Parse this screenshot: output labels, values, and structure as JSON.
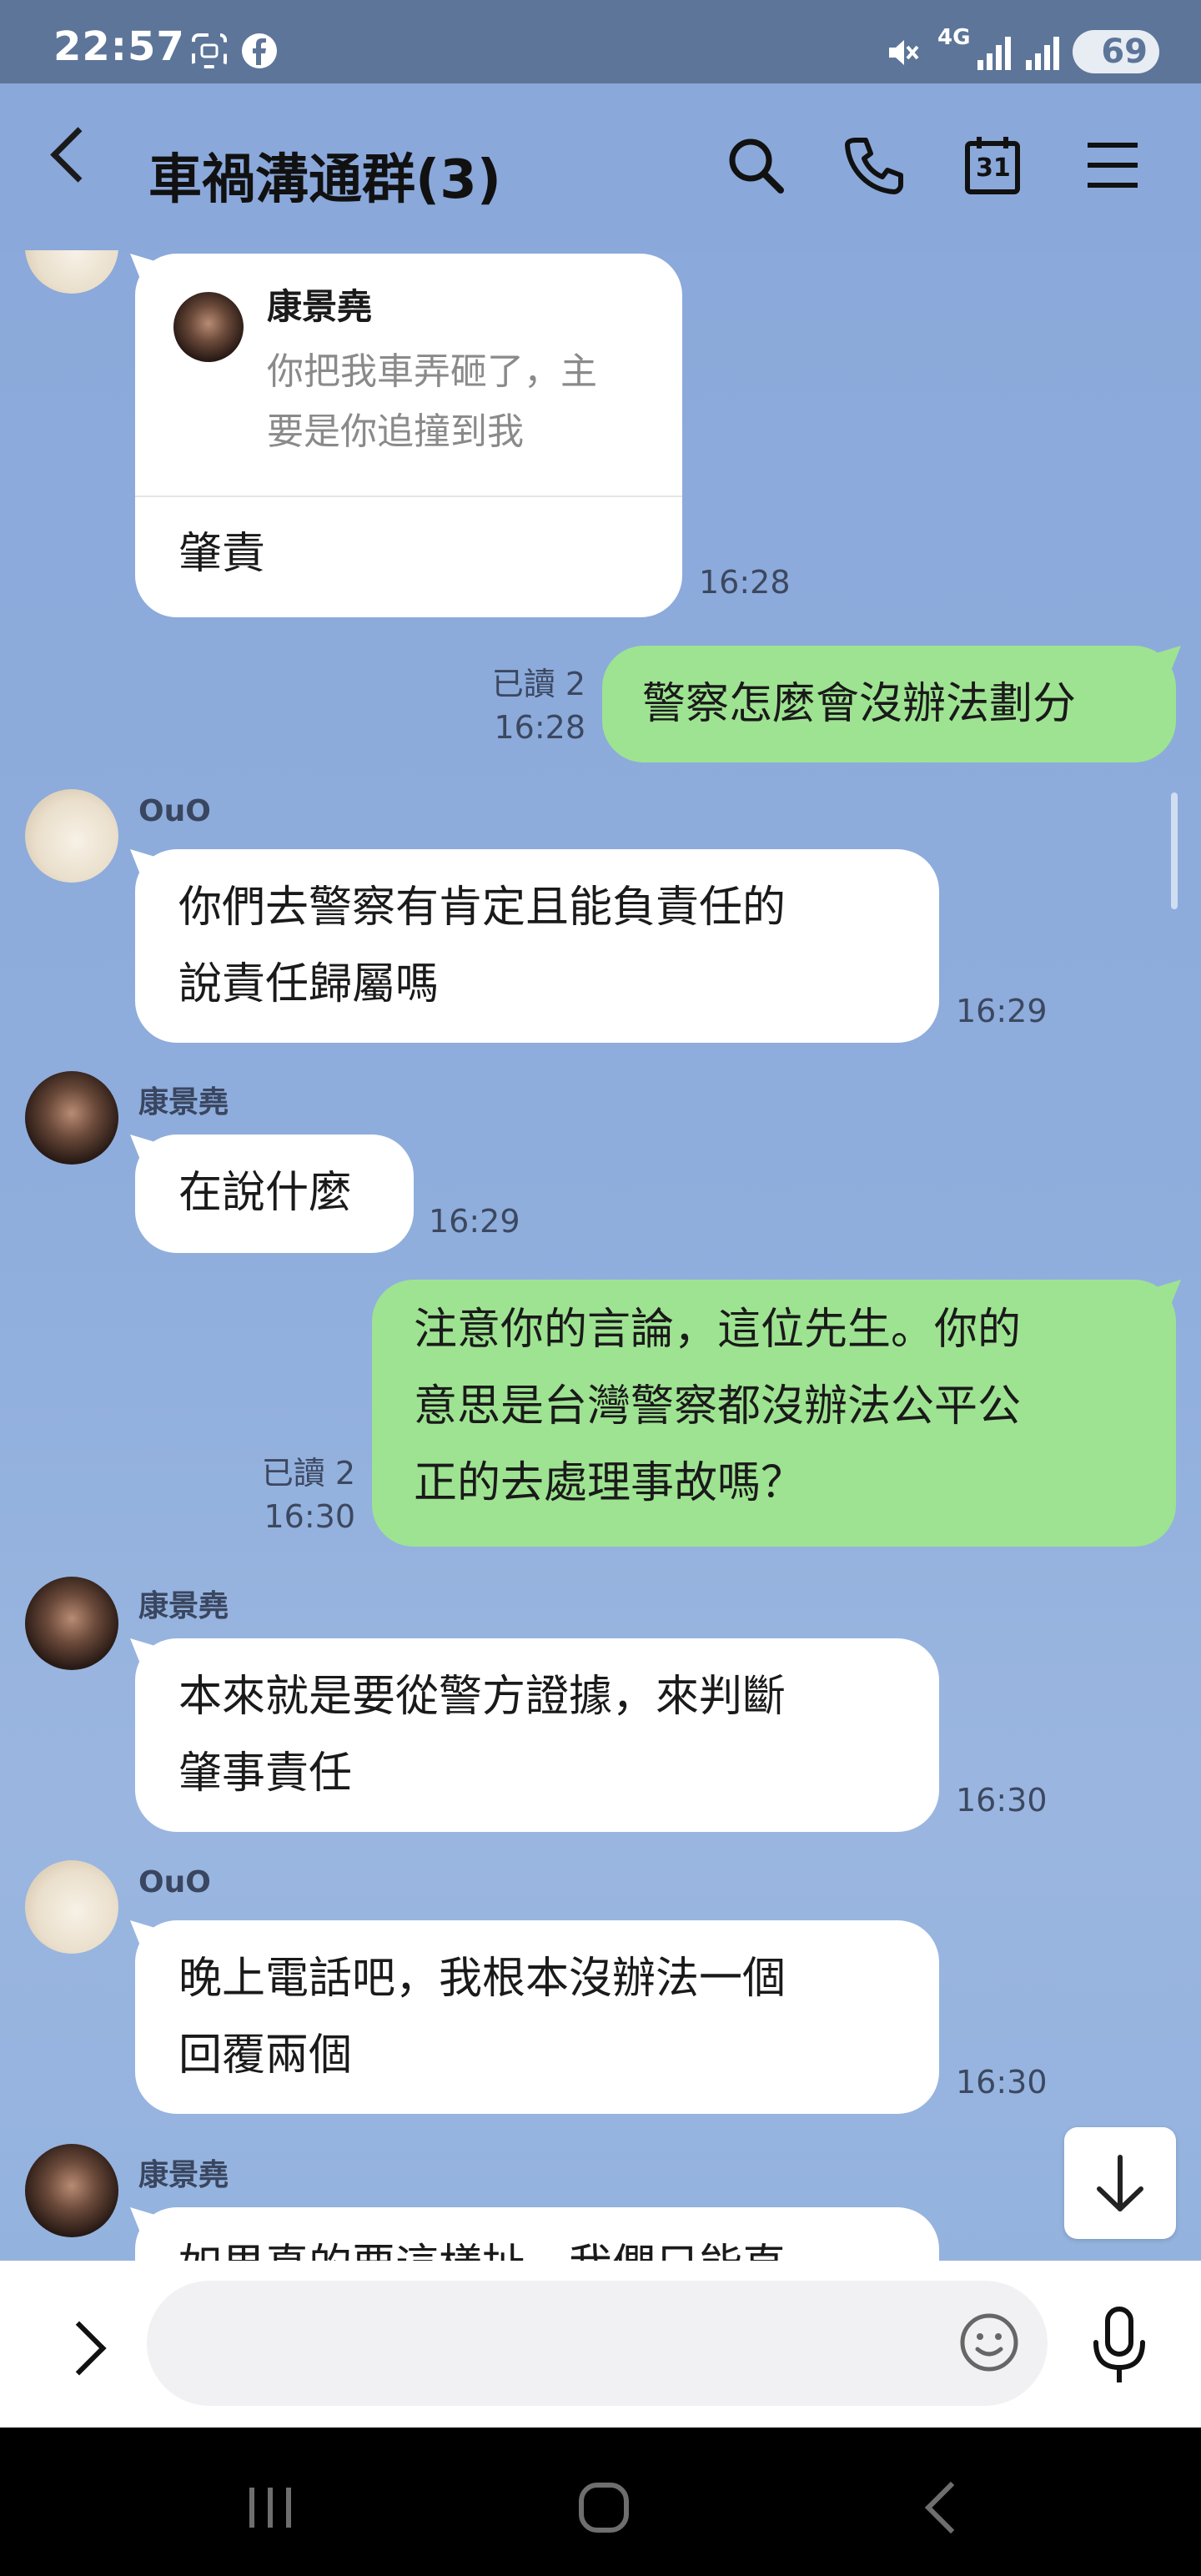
{
  "status_bar": {
    "time": "22:57",
    "network": "4G",
    "battery": "69",
    "icons": [
      "screenshot-icon",
      "facebook-icon",
      "mute-icon",
      "signal-icon",
      "signal-icon",
      "battery-icon"
    ]
  },
  "header": {
    "title": "車禍溝通群(3)",
    "icons": [
      "back-icon",
      "search-icon",
      "phone-icon",
      "calendar-icon",
      "menu-icon"
    ],
    "calendar_day": "31"
  },
  "messages": [
    {
      "id": "m1",
      "side": "left",
      "sender": "康景堯",
      "reply": {
        "name": "康景堯",
        "text": "你把我車弄砸了，主要是你追撞到我"
      },
      "text": "肇責",
      "time": "16:28"
    },
    {
      "id": "m2",
      "side": "right",
      "read": "已讀 2",
      "text": "警察怎麼會沒辦法劃分",
      "time": "16:28"
    },
    {
      "id": "m3",
      "side": "left",
      "sender": "OuO",
      "text": "你們去警察有肯定且能負責任的說責任歸屬嗎",
      "time": "16:29"
    },
    {
      "id": "m4",
      "side": "left",
      "sender": "康景堯",
      "text": "在說什麼",
      "time": "16:29"
    },
    {
      "id": "m5",
      "side": "right",
      "read": "已讀 2",
      "text": "注意你的言論，這位先生。你的意思是台灣警察都沒辦法公平公正的去處理事故嗎？",
      "time": "16:30"
    },
    {
      "id": "m6",
      "side": "left",
      "sender": "康景堯",
      "text": "本來就是要從警方證據，來判斷肇事責任",
      "time": "16:30"
    },
    {
      "id": "m7",
      "side": "left",
      "sender": "OuO",
      "text": "晚上電話吧，我根本沒辦法一個回覆兩個",
      "time": "16:30"
    },
    {
      "id": "m8",
      "side": "left",
      "sender": "康景堯",
      "text": "如果真的要這樣扯，我們只能直",
      "time": ""
    }
  ],
  "lines": {
    "m1_reply": [
      "你把我車弄砸了，主",
      "要是你追撞到我"
    ],
    "m3": [
      "你們去警察有肯定且能負責任的",
      "說責任歸屬嗎"
    ],
    "m5": [
      "注意你的言論，這位先生。你的",
      "意思是台灣警察都沒辦法公平公",
      "正的去處理事故嗎？"
    ],
    "m6": [
      "本來就是要從警方證據，來判斷",
      "肇事責任"
    ],
    "m7": [
      "晚上電話吧，我根本沒辦法一個",
      "回覆兩個"
    ]
  },
  "input_bar": {
    "placeholder": "",
    "icons": [
      "expand-icon",
      "emoji-icon",
      "microphone-icon"
    ]
  },
  "scroll_down_icon": "arrow-down-icon",
  "colors": {
    "header_bg": "#8aa8da",
    "status_bg": "#5d7599",
    "my_bubble": "#9ee391",
    "other_bubble": "#ffffff"
  }
}
